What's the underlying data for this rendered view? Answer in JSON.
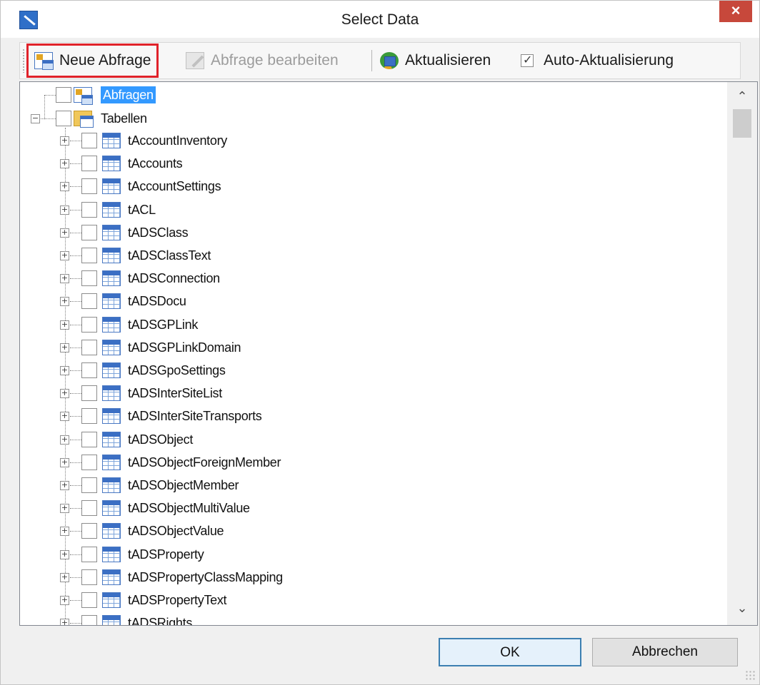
{
  "window": {
    "title": "Select Data",
    "close_label": "×"
  },
  "toolbar": {
    "new_query_label": "Neue Abfrage",
    "edit_query_label": "Abfrage bearbeiten",
    "refresh_label": "Aktualisieren",
    "auto_refresh_label": "Auto-Aktualisierung",
    "auto_refresh_checked": true
  },
  "tree": {
    "root_nodes": [
      {
        "label": "Abfragen",
        "icon": "query-icon",
        "selected": true,
        "expanded": false
      },
      {
        "label": "Tabellen",
        "icon": "tables-folder-icon",
        "selected": false,
        "expanded": true
      }
    ],
    "tables": [
      "tAccountInventory",
      "tAccounts",
      "tAccountSettings",
      "tACL",
      "tADSClass",
      "tADSClassText",
      "tADSConnection",
      "tADSDocu",
      "tADSGPLink",
      "tADSGPLinkDomain",
      "tADSGpoSettings",
      "tADSInterSiteList",
      "tADSInterSiteTransports",
      "tADSObject",
      "tADSObjectForeignMember",
      "tADSObjectMember",
      "tADSObjectMultiValue",
      "tADSObjectValue",
      "tADSProperty",
      "tADSPropertyClassMapping",
      "tADSPropertyText",
      "tADSRights"
    ],
    "scroll_position": 0.0
  },
  "buttons": {
    "ok_label": "OK",
    "cancel_label": "Abbrechen"
  },
  "colors": {
    "selection": "#3399ff",
    "highlight_border": "#e0222a",
    "close_button": "#c7483b"
  }
}
